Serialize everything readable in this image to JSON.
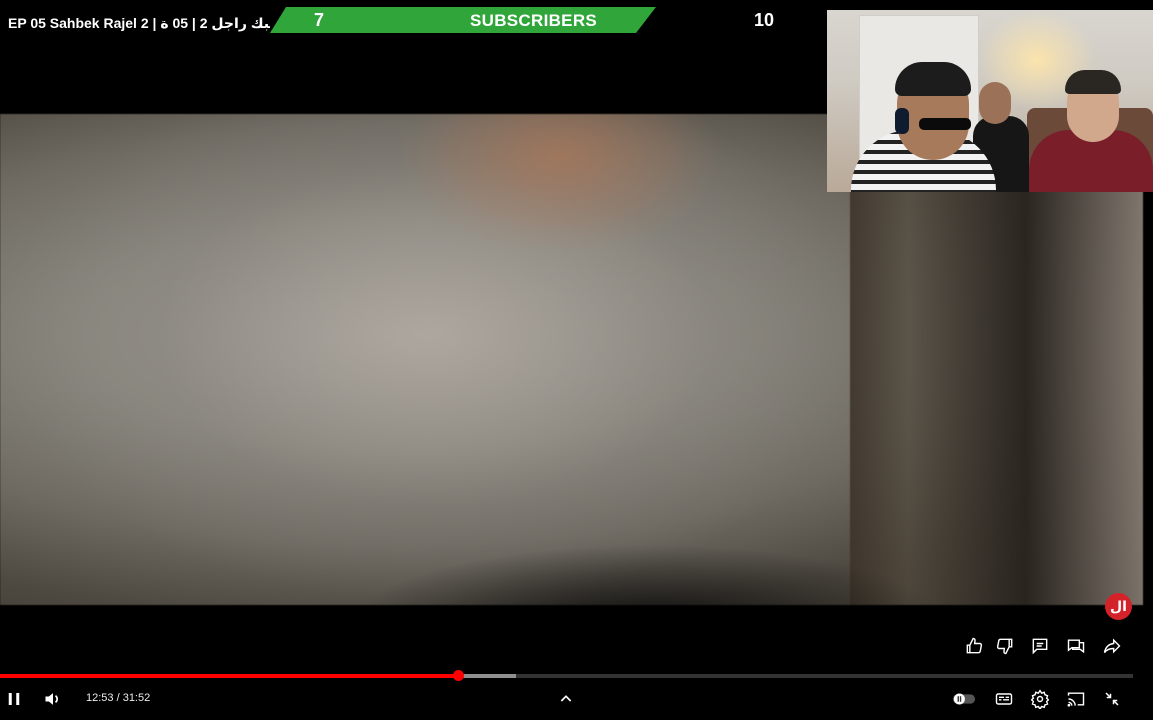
{
  "header": {
    "video_title": "EP 05 Sahbek Rajel 2 | صاحبك راجل 2 | 05 ة"
  },
  "overlay": {
    "subscriber_count_left": "7",
    "subscriber_label": "SUBSCRIBERS",
    "subscriber_count_right": "10",
    "bar_color": "#2fa53a"
  },
  "channel_logo": {
    "text": "ال",
    "color": "#d4222a"
  },
  "player": {
    "current_time": "12:53",
    "duration": "31:52",
    "time_display": "12:53 / 31:52",
    "progress_played_fraction": 0.404,
    "progress_buffered_fraction": 0.455,
    "accent_color": "#ff0000"
  },
  "actions": [
    "like-icon",
    "dislike-icon",
    "comment-icon",
    "live-chat-icon",
    "share-icon"
  ],
  "controls": {
    "left": [
      "pause-icon",
      "volume-icon"
    ],
    "center": [
      "chevron-up-icon"
    ],
    "right": [
      "autoplay-toggle-icon",
      "subtitles-icon",
      "settings-gear-icon",
      "cast-icon",
      "exit-fullscreen-icon"
    ]
  }
}
